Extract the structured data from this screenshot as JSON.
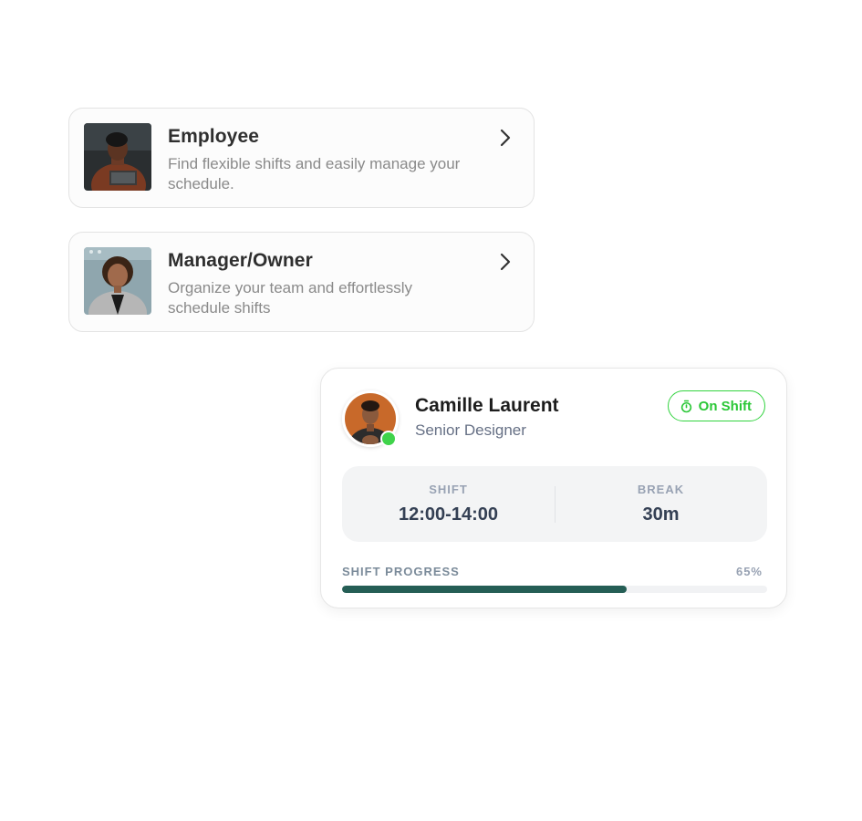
{
  "roles": [
    {
      "title": "Employee",
      "description": "Find flexible shifts and easily manage your schedule.",
      "photo_icon": "employee-photo",
      "chevron_icon": "chevron-right-icon"
    },
    {
      "title": "Manager/Owner",
      "description": "Organize your team and effortlessly schedule shifts",
      "photo_icon": "manager-photo",
      "chevron_icon": "chevron-right-icon"
    }
  ],
  "shift_card": {
    "name": "Camille Laurent",
    "job_title": "Senior Designer",
    "status": {
      "label": "On Shift",
      "icon": "stopwatch-icon",
      "color": "#2bc737"
    },
    "online_color": "#3fd34a",
    "stats": [
      {
        "label": "SHIFT",
        "value": "12:00-14:00"
      },
      {
        "label": "BREAK",
        "value": "30m"
      }
    ],
    "progress": {
      "label": "SHIFT PROGRESS",
      "percent_text": "65%",
      "fraction": 0.67,
      "color": "#255e55"
    }
  }
}
